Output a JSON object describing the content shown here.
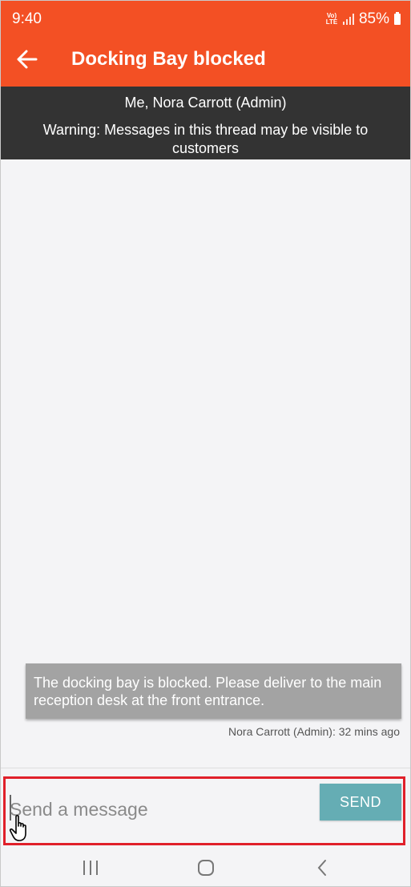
{
  "status_bar": {
    "time": "9:40",
    "network": "Vo) LTE",
    "battery": "85%"
  },
  "header": {
    "title": "Docking Bay blocked",
    "back_icon": "arrow-left-icon"
  },
  "thread_info": {
    "participants": "Me, Nora Carrott (Admin)",
    "warning": "Warning: Messages in this thread may be visible to customers"
  },
  "messages": [
    {
      "text": "The docking bay is blocked. Please deliver to the main reception desk at the front entrance.",
      "meta": "Nora Carrott (Admin): 32 mins ago"
    }
  ],
  "composer": {
    "placeholder": "Send a message",
    "send_label": "SEND"
  },
  "navbar": {
    "icons": [
      "recent-apps-icon",
      "home-icon",
      "back-icon"
    ]
  },
  "colors": {
    "accent": "#f35024",
    "send": "#65adb4",
    "highlight": "#e0202a"
  }
}
